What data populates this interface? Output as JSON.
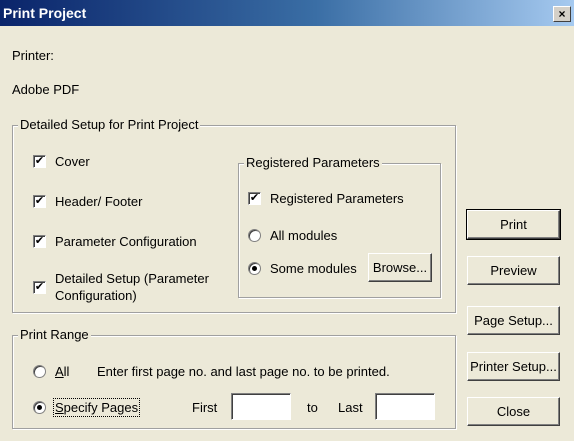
{
  "window": {
    "title": "Print Project",
    "close_glyph": "×"
  },
  "printer": {
    "label": "Printer:",
    "name": "Adobe PDF"
  },
  "detailed_setup": {
    "legend": "Detailed Setup for Print Project",
    "options": [
      {
        "label": "Cover",
        "checked": true
      },
      {
        "label": "Header/ Footer",
        "checked": true
      },
      {
        "label": "Parameter Configuration",
        "checked": true
      },
      {
        "label_line1": "Detailed Setup (Parameter",
        "label_line2": "Configuration)",
        "checked": true
      }
    ],
    "check_glyph": "✔"
  },
  "registered_parameters": {
    "legend": "Registered Parameters",
    "checkbox_label": "Registered Parameters",
    "checkbox_checked": true,
    "all_modules_label": "All modules",
    "some_modules_label": "Some modules",
    "selected": "Some modules",
    "browse_label": "Browse..."
  },
  "print_range": {
    "legend": "Print Range",
    "all_hotkey": "A",
    "all_rest": "ll",
    "hint": "Enter first page no. and last page no. to be printed.",
    "specify_hotkey": "S",
    "specify_rest": "pecify Pages",
    "selected": "Specify Pages",
    "first_label": "First",
    "first_value": "",
    "to_label": "to",
    "last_label": "Last",
    "last_value": ""
  },
  "buttons": {
    "print": "Print",
    "preview": "Preview",
    "page_setup": "Page Setup...",
    "printer_setup": "Printer Setup...",
    "close": "Close"
  }
}
